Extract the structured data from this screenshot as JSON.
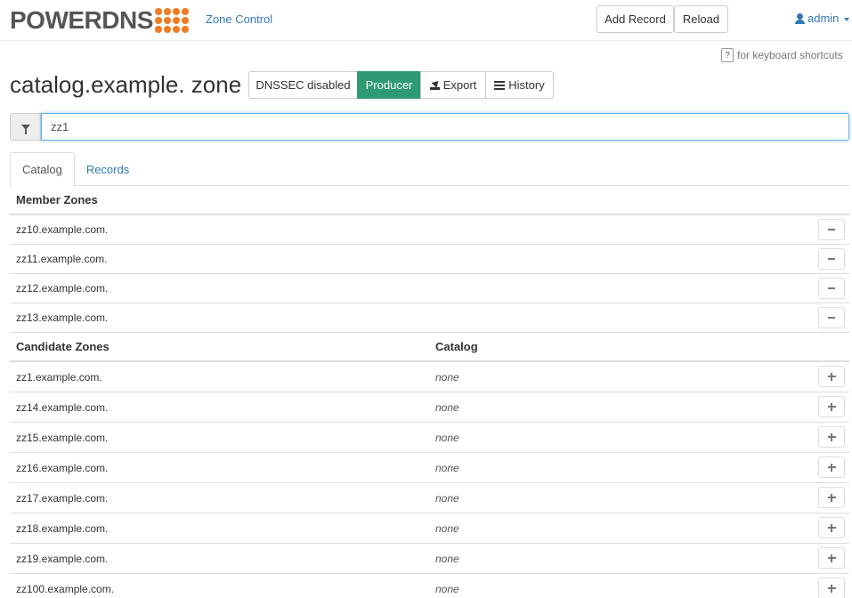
{
  "nav": {
    "logo_text": "POWERDNS",
    "zone_control_label": "Zone Control",
    "add_record_label": "Add Record",
    "reload_label": "Reload",
    "user_label": "admin"
  },
  "keyboard_hint": {
    "key": "?",
    "text": "for keyboard shortcuts"
  },
  "zone": {
    "title": "catalog.example. zone",
    "dnssec_label": "DNSSEC disabled",
    "producer_label": "Producer",
    "export_label": "Export",
    "history_label": "History"
  },
  "filter": {
    "value": "zz1"
  },
  "tabs": [
    {
      "label": "Catalog",
      "active": true
    },
    {
      "label": "Records",
      "active": false
    }
  ],
  "member_zones": {
    "header": "Member Zones",
    "rows": [
      "zz10.example.com.",
      "zz11.example.com.",
      "zz12.example.com.",
      "zz13.example.com."
    ]
  },
  "candidate_zones": {
    "header": "Candidate Zones",
    "catalog_header": "Catalog",
    "rows": [
      {
        "zone": "zz1.example.com.",
        "catalog": "none"
      },
      {
        "zone": "zz14.example.com.",
        "catalog": "none"
      },
      {
        "zone": "zz15.example.com.",
        "catalog": "none"
      },
      {
        "zone": "zz16.example.com.",
        "catalog": "none"
      },
      {
        "zone": "zz17.example.com.",
        "catalog": "none"
      },
      {
        "zone": "zz18.example.com.",
        "catalog": "none"
      },
      {
        "zone": "zz19.example.com.",
        "catalog": "none"
      },
      {
        "zone": "zz100.example.com.",
        "catalog": "none"
      }
    ]
  },
  "colors": {
    "accent": "#f07b22",
    "link": "#337ab7",
    "producer": "#2e9a73"
  }
}
